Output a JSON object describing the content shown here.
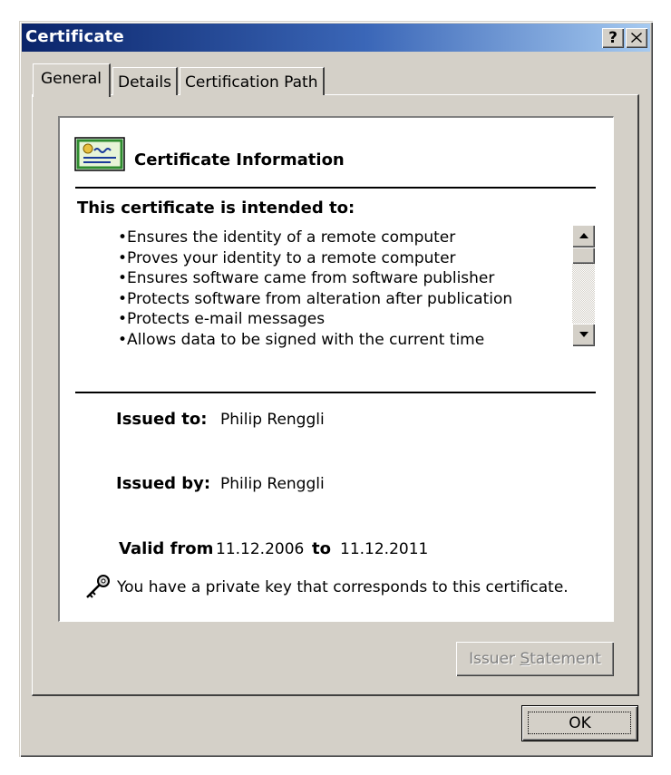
{
  "window": {
    "title": "Certificate",
    "help_label": "?",
    "close_label": "✕"
  },
  "tabs": [
    {
      "label": "General",
      "active": true
    },
    {
      "label": "Details",
      "active": false
    },
    {
      "label": "Certification Path",
      "active": false
    }
  ],
  "info": {
    "heading": "Certificate Information",
    "intended_heading": "This certificate is intended to:",
    "purposes": [
      "Ensures the identity of a remote computer",
      "Proves your identity to a remote computer",
      "Ensures software came from software publisher",
      "Protects software from alteration after publication",
      "Protects e-mail messages",
      "Allows data to be signed with the current time"
    ],
    "issued_to_label": "Issued to:",
    "issued_to_value": "Philip Renggli",
    "issued_by_label": "Issued by:",
    "issued_by_value": "Philip Renggli",
    "valid_from_label": "Valid from",
    "valid_from_value": "11.12.2006",
    "valid_to_label": "to",
    "valid_to_value": "11.12.2011",
    "private_key_note": "You have a private key that corresponds to this certificate."
  },
  "buttons": {
    "issuer_statement_pre": "Issuer ",
    "issuer_statement_mnemonic": "S",
    "issuer_statement_post": "tatement",
    "ok": "OK"
  },
  "icons": {
    "certificate": "certificate-icon",
    "key": "key-icon",
    "scroll_up": "scroll-up-arrow-icon",
    "scroll_down": "scroll-down-arrow-icon"
  },
  "colors": {
    "title_gradient_start": "#0a246a",
    "title_gradient_end": "#a6caf0",
    "face": "#d4d0c8"
  }
}
